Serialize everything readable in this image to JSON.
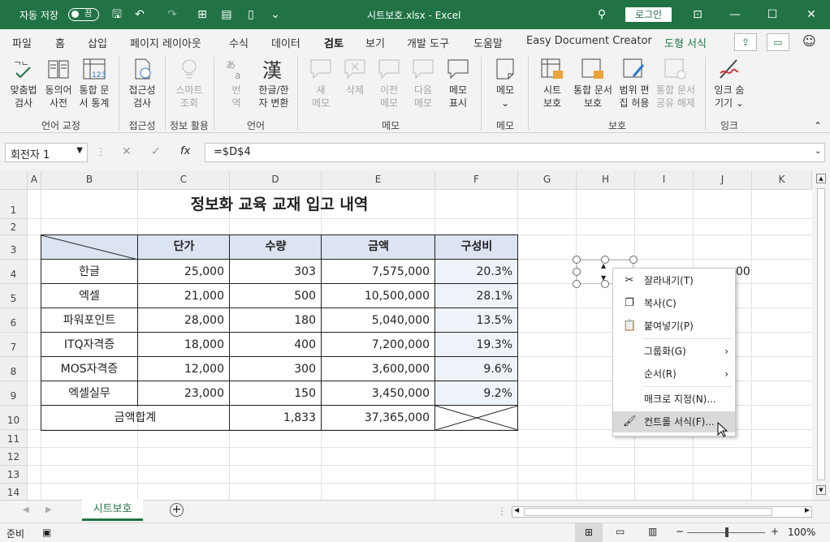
{
  "titlebar": {
    "autosave": "자동 저장",
    "toggle": "끔",
    "title": "시트보호.xlsx  -  Excel",
    "login": "로그인"
  },
  "tabs": [
    "파일",
    "홈",
    "삽입",
    "페이지 레이아웃",
    "수식",
    "데이터",
    "검토",
    "보기",
    "개발 도구",
    "도움말",
    "Easy Document Creator",
    "도형 서식"
  ],
  "ribbon": {
    "buttons": [
      {
        "l1": "맞춤법",
        "l2": "검사"
      },
      {
        "l1": "동의어",
        "l2": "사전"
      },
      {
        "l1": "통합 문",
        "l2": "서 통계"
      },
      {
        "l1": "접근성",
        "l2": "검사"
      },
      {
        "l1": "스마트",
        "l2": "조회"
      },
      {
        "l1": "번",
        "l2": "역"
      },
      {
        "l1": "한글/한",
        "l2": "자 변환"
      },
      {
        "l1": "새",
        "l2": "메모"
      },
      {
        "l1": "삭제",
        "l2": ""
      },
      {
        "l1": "이전",
        "l2": "메모"
      },
      {
        "l1": "다음",
        "l2": "메모"
      },
      {
        "l1": "메모",
        "l2": "표시"
      },
      {
        "l1": "메모",
        "l2": "⌄"
      },
      {
        "l1": "시트",
        "l2": "보호"
      },
      {
        "l1": "통합 문서",
        "l2": "보호"
      },
      {
        "l1": "범위 편",
        "l2": "집 허용"
      },
      {
        "l1": "통합 문서",
        "l2": "공유 해제"
      },
      {
        "l1": "잉크 숨",
        "l2": "기기 ⌄"
      }
    ],
    "groups": [
      "언어 교정",
      "접근성",
      "정보 활용",
      "언어",
      "메모",
      "메모",
      "보호",
      "잉크"
    ]
  },
  "formula_bar": {
    "name_box": "회전자 1",
    "fx": "fx",
    "formula": "=$D$4"
  },
  "columns": [
    "A",
    "B",
    "C",
    "D",
    "E",
    "F",
    "G",
    "H",
    "I",
    "J",
    "K"
  ],
  "rows": [
    "1",
    "2",
    "3",
    "4",
    "5",
    "6",
    "7",
    "8",
    "9",
    "10",
    "11",
    "12",
    "13",
    "14"
  ],
  "sheet": {
    "title": "정보화 교육 교재 입고 내역",
    "headers": [
      "단가",
      "수량",
      "금액",
      "구성비"
    ],
    "data": [
      [
        "한글",
        "25,000",
        "303",
        "7,575,000",
        "20.3%"
      ],
      [
        "엑셀",
        "21,000",
        "500",
        "10,500,000",
        "28.1%"
      ],
      [
        "파워포인트",
        "28,000",
        "180",
        "5,040,000",
        "13.5%"
      ],
      [
        "ITQ자격증",
        "18,000",
        "400",
        "7,200,000",
        "19.3%"
      ],
      [
        "MOS자격증",
        "12,000",
        "300",
        "3,600,000",
        "9.6%"
      ],
      [
        "엑셀실무",
        "23,000",
        "150",
        "3,450,000",
        "9.2%"
      ]
    ],
    "total": {
      "label": "금액합계",
      "qty": "1,833",
      "amount": "37,365,000"
    },
    "j4": "00"
  },
  "context_menu": [
    {
      "label": "잘라내기(T)",
      "icon": "cut-icon"
    },
    {
      "label": "복사(C)",
      "icon": "copy-icon"
    },
    {
      "label": "붙여넣기(P)",
      "icon": "paste-icon"
    },
    {
      "label": "그룹화(G)",
      "icon": ""
    },
    {
      "label": "순서(R)",
      "icon": ""
    },
    {
      "label": "매크로 지정(N)...",
      "icon": ""
    },
    {
      "label": "컨트롤 서식(F)...",
      "icon": "format-control-icon"
    }
  ],
  "sheet_tab": "시트보호",
  "status": {
    "ready": "준비",
    "zoom": "100%"
  },
  "colors": {
    "accent": "#217346",
    "header_fill": "#dce3f1",
    "pct_fill": "#edf3f8"
  }
}
